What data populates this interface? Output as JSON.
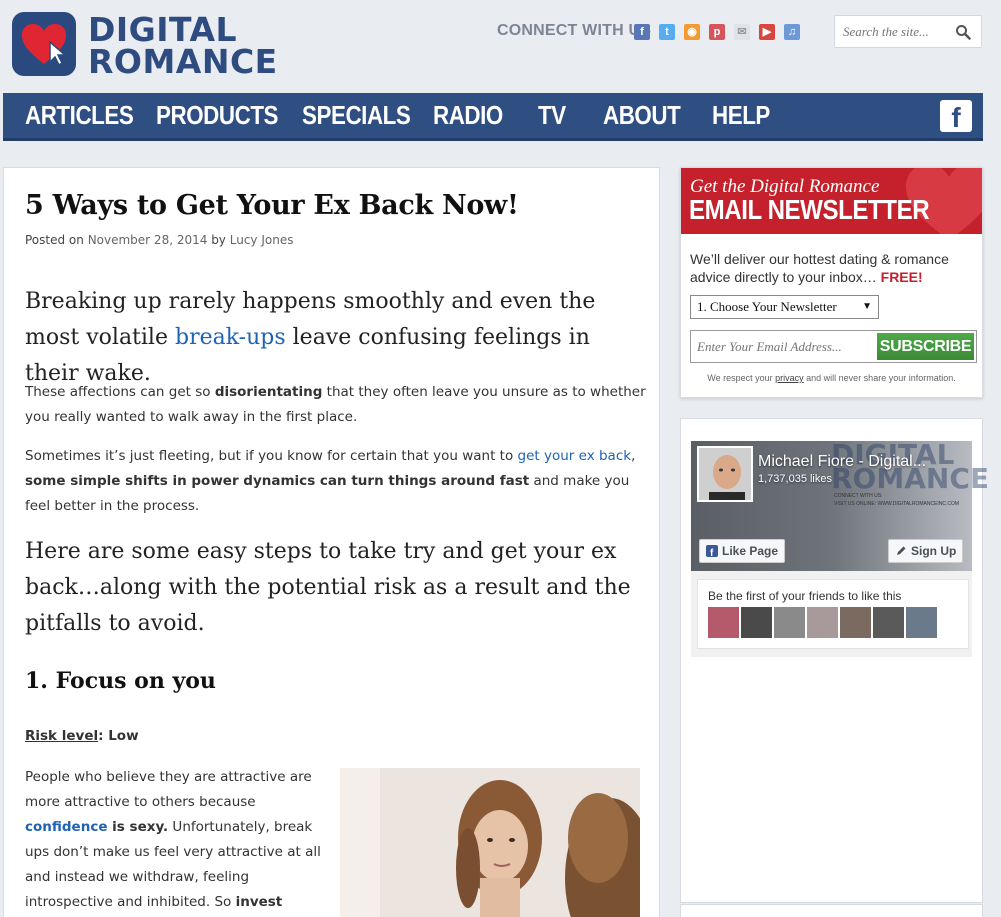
{
  "brand": {
    "line1": "DIGITAL",
    "line2": "ROMANCE",
    "accent": "#e02633",
    "navy": "#2f4f82"
  },
  "header": {
    "connect_label": "CONNECT WITH US",
    "social_icons": [
      "facebook-icon",
      "twitter-icon",
      "rss-icon",
      "pinterest-icon",
      "email-icon",
      "youtube-icon",
      "itunes-icon"
    ],
    "search_placeholder": "Search the site..."
  },
  "nav": {
    "items": [
      "ARTICLES",
      "PRODUCTS",
      "SPECIALS",
      "RADIO",
      "TV",
      "ABOUT",
      "HELP"
    ],
    "fb_glyph": "f"
  },
  "article": {
    "title": "5 Ways to Get Your Ex Back Now!",
    "meta": {
      "posted_on": "Posted on ",
      "date": "November 28, 2014",
      "by": " by ",
      "author": "Lucy Jones"
    },
    "lead": {
      "part1": "Breaking up rarely happens smoothly and even the most volatile ",
      "link": "break-ups",
      "part2": " leave confusing feelings in their wake."
    },
    "p1": {
      "part1": "These affections can get so ",
      "bold": "disorientating",
      "part2": " that they often leave you unsure as to whether you really wanted to walk away in the first place."
    },
    "p2": {
      "part1": "Sometimes it’s just fleeting, but if you know for certain that you want to ",
      "link": "get your ex back",
      "part2": ", ",
      "bold": "some simple shifts in power dynamics can turn things around fast",
      "part3": " and make you feel better in the process."
    },
    "subhead": "Here are some easy steps to take try and get your ex back…along with the potential risk as a result and the pitfalls to avoid.",
    "section1_title": "1. Focus on you",
    "risk": {
      "label": "Risk level",
      "value": ": Low"
    },
    "body": {
      "part1": "People who believe they are attractive are more attractive to others because ",
      "link": "confidence",
      "bold": " is sexy.",
      "part2": " Unfortunately, break ups don’t make us feel very attractive at all and instead we withdraw, feeling introspective and inhibited. So ",
      "bold2": "invest some"
    }
  },
  "newsletter": {
    "heading_script": "Get the Digital Romance",
    "heading_main": "EMAIL NEWSLETTER",
    "desc": "We’ll deliver our hottest dating & romance advice directly to your inbox… ",
    "free": "FREE!",
    "select_value": "1. Choose Your Newsletter",
    "email_placeholder": "Enter Your Email Address...",
    "subscribe_label": "SUBSCRIBE",
    "privacy_part1": "We respect your ",
    "privacy_link": "privacy",
    "privacy_part2": " and will never share your information."
  },
  "facebook_widget": {
    "page_name": "Michael Fiore - Digital...",
    "likes": "1,737,035 likes",
    "cover_watermark_1": "DIGITAL",
    "cover_watermark_2": "ROMANCE",
    "cover_tiny_1": "CONNECT WITH US:",
    "cover_tiny_2": "VISIT US ONLINE: WWW.DIGITALROMANCEINC.COM",
    "like_label": "Like Page",
    "signup_label": "Sign Up",
    "friends_text": "Be the first of your friends to like this",
    "friend_face_colors": [
      "#b45a6a",
      "#4a4a4a",
      "#8a8a8a",
      "#a89a9a",
      "#7a6a60",
      "#5a5a5a",
      "#6a7a8a"
    ]
  }
}
